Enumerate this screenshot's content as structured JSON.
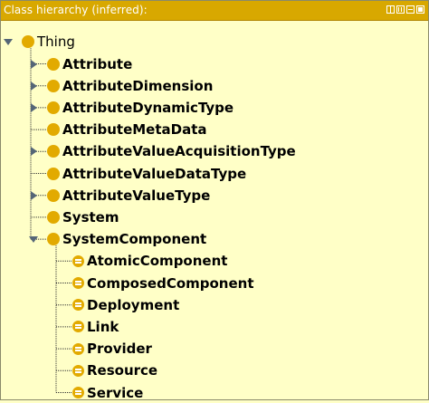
{
  "panel": {
    "title": "Class hierarchy (inferred):",
    "buttons": [
      "split-view",
      "columns-view",
      "minimize",
      "maximize"
    ]
  },
  "tree": {
    "root": {
      "label": "Thing",
      "expanded": true,
      "icon": "class-icon",
      "children": [
        {
          "label": "Attribute",
          "has_children": true,
          "expanded": false,
          "icon": "class-icon"
        },
        {
          "label": "AttributeDimension",
          "has_children": true,
          "expanded": false,
          "icon": "class-icon"
        },
        {
          "label": "AttributeDynamicType",
          "has_children": true,
          "expanded": false,
          "icon": "class-icon"
        },
        {
          "label": "AttributeMetaData",
          "has_children": false,
          "icon": "class-icon"
        },
        {
          "label": "AttributeValueAcquisitionType",
          "has_children": true,
          "expanded": false,
          "icon": "class-icon"
        },
        {
          "label": "AttributeValueDataType",
          "has_children": false,
          "icon": "class-icon"
        },
        {
          "label": "AttributeValueType",
          "has_children": true,
          "expanded": false,
          "icon": "class-icon"
        },
        {
          "label": "System",
          "has_children": false,
          "icon": "class-icon"
        },
        {
          "label": "SystemComponent",
          "has_children": true,
          "expanded": true,
          "icon": "class-icon",
          "children": [
            {
              "label": "AtomicComponent",
              "icon": "defined-class-icon"
            },
            {
              "label": "ComposedComponent",
              "icon": "defined-class-icon"
            },
            {
              "label": "Deployment",
              "icon": "defined-class-icon"
            },
            {
              "label": "Link",
              "icon": "defined-class-icon"
            },
            {
              "label": "Provider",
              "icon": "defined-class-icon"
            },
            {
              "label": "Resource",
              "icon": "defined-class-icon"
            },
            {
              "label": "Service",
              "icon": "defined-class-icon"
            }
          ]
        }
      ]
    }
  },
  "colors": {
    "background": "#ffffc7",
    "titlebar": "#d8a800",
    "class_icon": "#e2aa00",
    "toggle": "#556677"
  }
}
